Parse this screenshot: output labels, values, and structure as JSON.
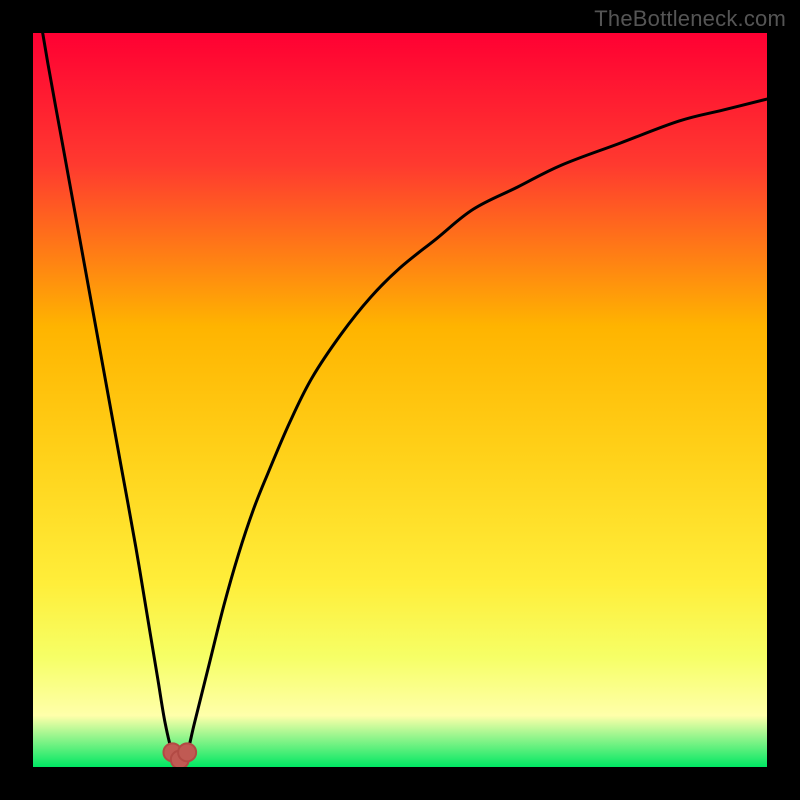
{
  "watermark": "TheBottleneck.com",
  "colors": {
    "frame": "#000000",
    "curve": "#000000",
    "marker": "#c05a53",
    "marker_stroke": "#b24a44",
    "gradient_top": "#ff0033",
    "gradient_mid1": "#ff5a2a",
    "gradient_mid2": "#ffb400",
    "gradient_mid3": "#ffee3a",
    "gradient_mid4": "#f6ff66",
    "gradient_mid5": "#ffffaa",
    "gradient_bottom": "#00e763"
  },
  "chart_data": {
    "type": "line",
    "title": "",
    "xlabel": "",
    "ylabel": "",
    "xlim": [
      0,
      100
    ],
    "ylim": [
      0,
      100
    ],
    "grid": false,
    "legend": false,
    "series": [
      {
        "name": "bottleneck-curve",
        "x": [
          0,
          2,
          4,
          6,
          8,
          10,
          12,
          14,
          16,
          17,
          18,
          19,
          20,
          21,
          22,
          24,
          26,
          28,
          30,
          32,
          35,
          38,
          42,
          46,
          50,
          55,
          60,
          66,
          72,
          80,
          88,
          94,
          100
        ],
        "y": [
          108,
          96,
          85,
          74,
          63,
          52,
          41,
          30,
          18,
          12,
          6,
          2,
          1,
          2,
          6,
          14,
          22,
          29,
          35,
          40,
          47,
          53,
          59,
          64,
          68,
          72,
          76,
          79,
          82,
          85,
          88,
          89.5,
          91
        ]
      }
    ],
    "markers": [
      {
        "name": "min-point-left",
        "x": 19,
        "y": 2
      },
      {
        "name": "min-point-mid",
        "x": 20,
        "y": 1
      },
      {
        "name": "min-point-right",
        "x": 21,
        "y": 2
      }
    ]
  }
}
